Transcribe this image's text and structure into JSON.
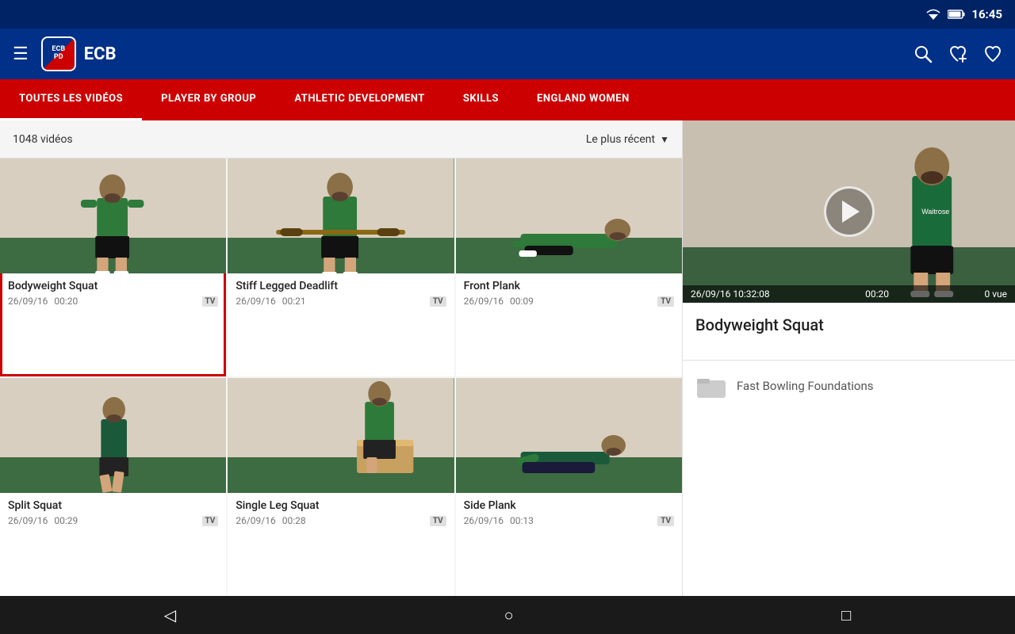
{
  "statusBar": {
    "time": "16:45"
  },
  "topBar": {
    "menuIcon": "☰",
    "logoText": "ECB",
    "appTitle": "ECB",
    "searchIcon": "search",
    "heartIcon": "❤",
    "favIcon": "♡"
  },
  "navTabs": [
    {
      "label": "TOUTES LES VIDÉOS",
      "active": true
    },
    {
      "label": "PLAYER BY GROUP",
      "active": false
    },
    {
      "label": "ATHLETIC DEVELOPMENT",
      "active": false
    },
    {
      "label": "SKILLS",
      "active": false
    },
    {
      "label": "ENGLAND WOMEN",
      "active": false
    }
  ],
  "filterBar": {
    "videoCount": "1048 vidéos",
    "sortLabel": "Le plus récent"
  },
  "videos": [
    {
      "title": "Bodyweight Squat",
      "date": "26/09/16",
      "duration": "00:20",
      "selected": true,
      "thumbType": "standing"
    },
    {
      "title": "Stiff Legged Deadlift",
      "date": "26/09/16",
      "duration": "00:21",
      "selected": false,
      "thumbType": "bar"
    },
    {
      "title": "Front Plank",
      "date": "26/09/16",
      "duration": "00:09",
      "selected": false,
      "thumbType": "plank"
    },
    {
      "title": "Split Squat",
      "date": "26/09/16",
      "duration": "00:29",
      "selected": false,
      "thumbType": "standing-side"
    },
    {
      "title": "Single Leg Squat",
      "date": "26/09/16",
      "duration": "00:28",
      "selected": false,
      "thumbType": "box"
    },
    {
      "title": "Side Plank",
      "date": "26/09/16",
      "duration": "00:13",
      "selected": false,
      "thumbType": "side-plank"
    }
  ],
  "preview": {
    "date": "26/09/16 10:32:08",
    "duration": "00:20",
    "views": "0 vue",
    "title": "Bodyweight Squat",
    "playlist": "Fast Bowling Foundations"
  },
  "bottomNav": {
    "backIcon": "◁",
    "homeIcon": "○",
    "recentIcon": "□"
  }
}
